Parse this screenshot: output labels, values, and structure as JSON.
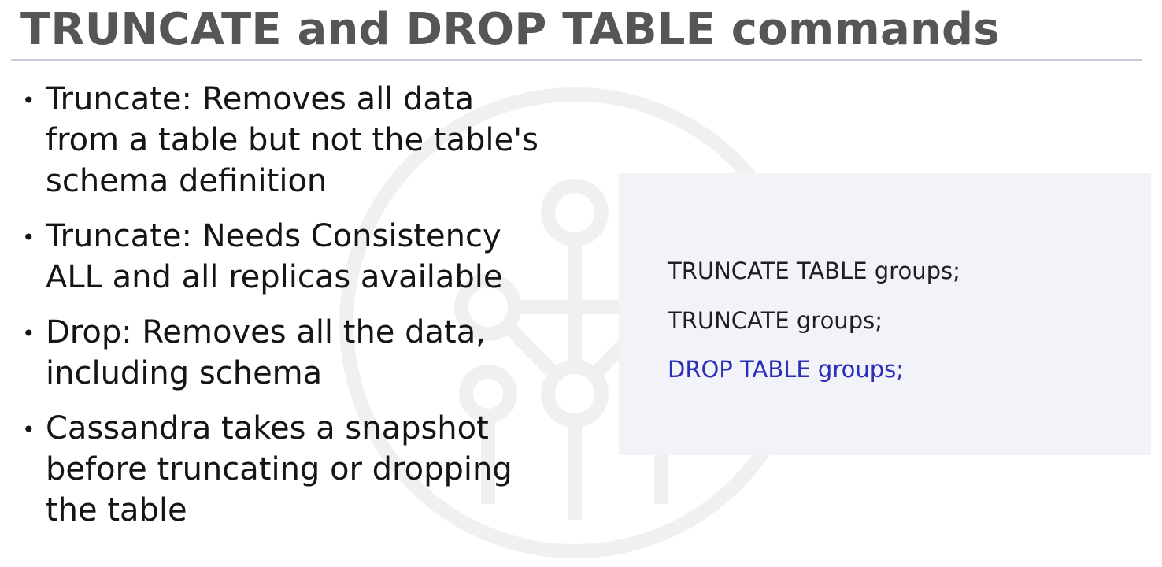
{
  "slide": {
    "title": "TRUNCATE and DROP TABLE commands",
    "bullets": [
      {
        "lines": [
          "Truncate: Removes all data",
          "from a table but not the table's",
          "schema definition"
        ]
      },
      {
        "lines": [
          "Truncate: Needs Consistency",
          "ALL and all replicas available"
        ]
      },
      {
        "lines": [
          "Drop: Removes all the data,",
          "including schema"
        ]
      },
      {
        "lines": [
          "Cassandra takes a snapshot",
          "before truncating or dropping",
          "the table"
        ]
      }
    ],
    "code": [
      "TRUNCATE TABLE groups;",
      "TRUNCATE groups;",
      "DROP TABLE groups;"
    ]
  },
  "colors": {
    "title": "#565656",
    "text": "#151515",
    "rule": "#c9c8dd",
    "panel_background": "#f2f3f8",
    "code_text": "#1f1f1f",
    "code_accent": "#2b2eb6",
    "watermark": "#f1f1f1"
  },
  "icons": {
    "watermark": "network-nodes-watermark-icon"
  }
}
